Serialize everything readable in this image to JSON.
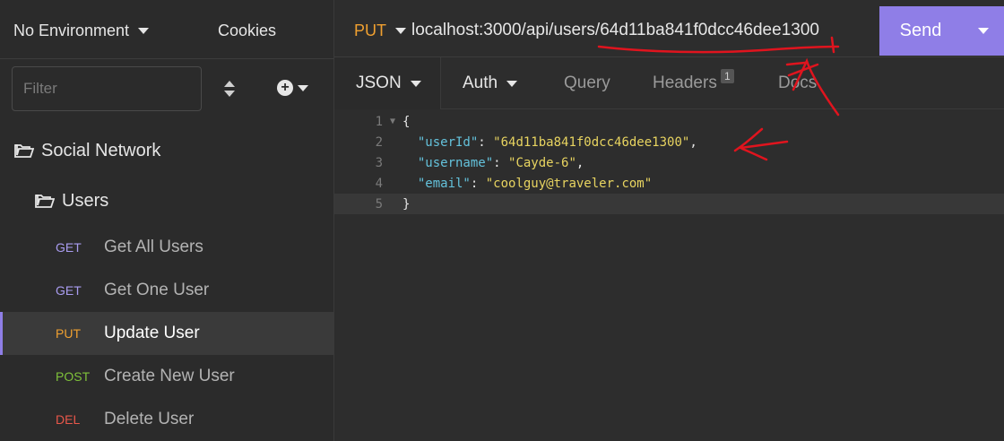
{
  "sidebar": {
    "environment": "No Environment",
    "cookies": "Cookies",
    "filter_placeholder": "Filter",
    "folder": "Social Network",
    "subfolder": "Users",
    "requests": [
      {
        "method": "GET",
        "label": "Get All Users",
        "method_color": "#a99cf0"
      },
      {
        "method": "GET",
        "label": "Get One User",
        "method_color": "#a99cf0"
      },
      {
        "method": "PUT",
        "label": "Update User",
        "method_color": "#f0a030"
      },
      {
        "method": "POST",
        "label": "Create New User",
        "method_color": "#7fc23a"
      },
      {
        "method": "DEL",
        "label": "Delete User",
        "method_color": "#e8574a"
      }
    ]
  },
  "request": {
    "method": "PUT",
    "url": "localhost:3000/api/users/64d11ba841f0dcc46dee1300",
    "send": "Send"
  },
  "tabs": {
    "body": "JSON",
    "auth": "Auth",
    "query": "Query",
    "headers": "Headers",
    "headers_count": "1",
    "docs": "Docs"
  },
  "editor": {
    "line_numbers": [
      "1",
      "2",
      "3",
      "4",
      "5"
    ],
    "open_brace": "{",
    "close_brace": "}",
    "fields": [
      {
        "key": "\"userId\"",
        "value": "\"64d11ba841f0dcc46dee1300\"",
        "trail": ","
      },
      {
        "key": "\"username\"",
        "value": "\"Cayde-6\"",
        "trail": ","
      },
      {
        "key": "\"email\"",
        "value": "\"coolguy@traveler.com\"",
        "trail": ""
      }
    ]
  },
  "colors": {
    "accent": "#8f7ee7",
    "annotation": "#e0141e"
  }
}
